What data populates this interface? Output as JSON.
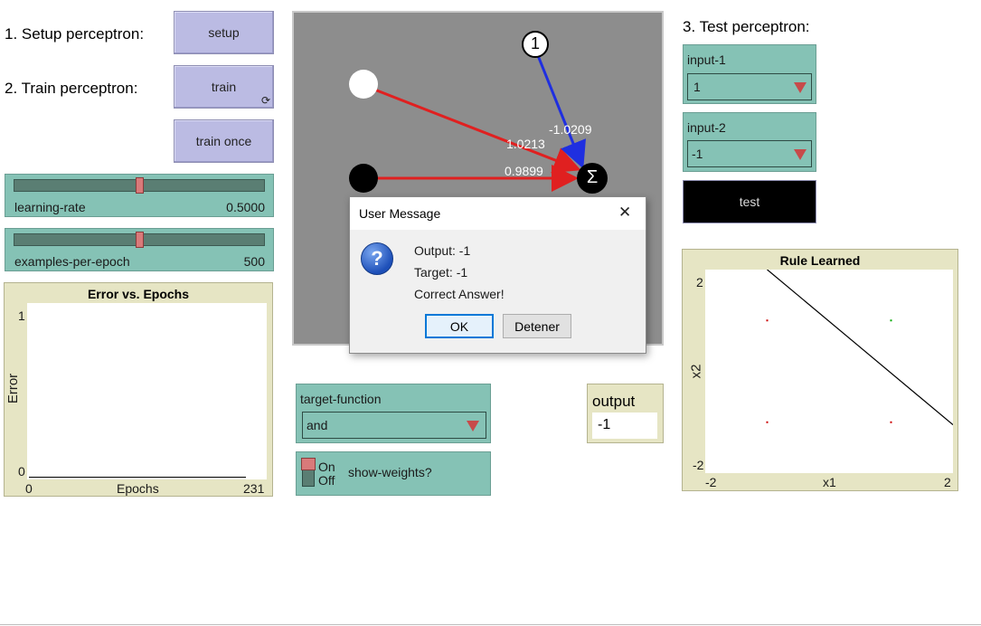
{
  "step_labels": {
    "setup": "1. Setup perceptron:",
    "train": "2. Train perceptron:",
    "test": "3. Test perceptron:"
  },
  "buttons": {
    "setup": "setup",
    "train": "train",
    "train_once": "train once",
    "test": "test"
  },
  "sliders": {
    "learning_rate": {
      "label": "learning-rate",
      "value": "0.5000",
      "fraction": 0.5
    },
    "examples_per_epoch": {
      "label": "examples-per-epoch",
      "value": "500",
      "fraction": 0.5
    }
  },
  "error_plot": {
    "title": "Error vs. Epochs",
    "ylabel": "Error",
    "xlabel": "Epochs",
    "y_max": "1",
    "y_min": "0",
    "x_min": "0",
    "x_max": "231"
  },
  "network": {
    "bias_symbol": "1",
    "sum_symbol": "Σ",
    "weights": {
      "bias": "-1.0209",
      "input1": "1.0213",
      "input2": "0.9899"
    }
  },
  "choosers": {
    "target_function": {
      "label": "target-function",
      "value": "and"
    },
    "input1": {
      "label": "input-1",
      "value": "1"
    },
    "input2": {
      "label": "input-2",
      "value": "-1"
    }
  },
  "switch": {
    "on": "On",
    "off": "Off",
    "label": "show-weights?"
  },
  "output_monitor": {
    "label": "output",
    "value": "-1"
  },
  "rule_plot": {
    "title": "Rule Learned",
    "xlabel": "x1",
    "ylabel": "x2",
    "x_min": "-2",
    "x_max": "2",
    "y_min": "-2",
    "y_max": "2"
  },
  "chart_data": {
    "type": "scatter",
    "title": "Rule Learned",
    "xlabel": "x1",
    "ylabel": "x2",
    "xlim": [
      -2,
      2
    ],
    "ylim": [
      -2,
      2
    ],
    "series": [
      {
        "color": "#cc0000",
        "points": [
          [
            -1,
            1
          ],
          [
            -1,
            -1
          ],
          [
            1,
            -1
          ]
        ]
      },
      {
        "color": "#00aa00",
        "points": [
          [
            1,
            1
          ]
        ]
      }
    ],
    "line": {
      "x": [
        -1.0,
        2.0
      ],
      "y": [
        2.0,
        -1.05
      ]
    }
  },
  "dialog": {
    "title": "User Message",
    "close_glyph": "✕",
    "lines": [
      "Output: -1",
      "Target: -1",
      "Correct Answer!"
    ],
    "ok": "OK",
    "stop": "Detener"
  }
}
